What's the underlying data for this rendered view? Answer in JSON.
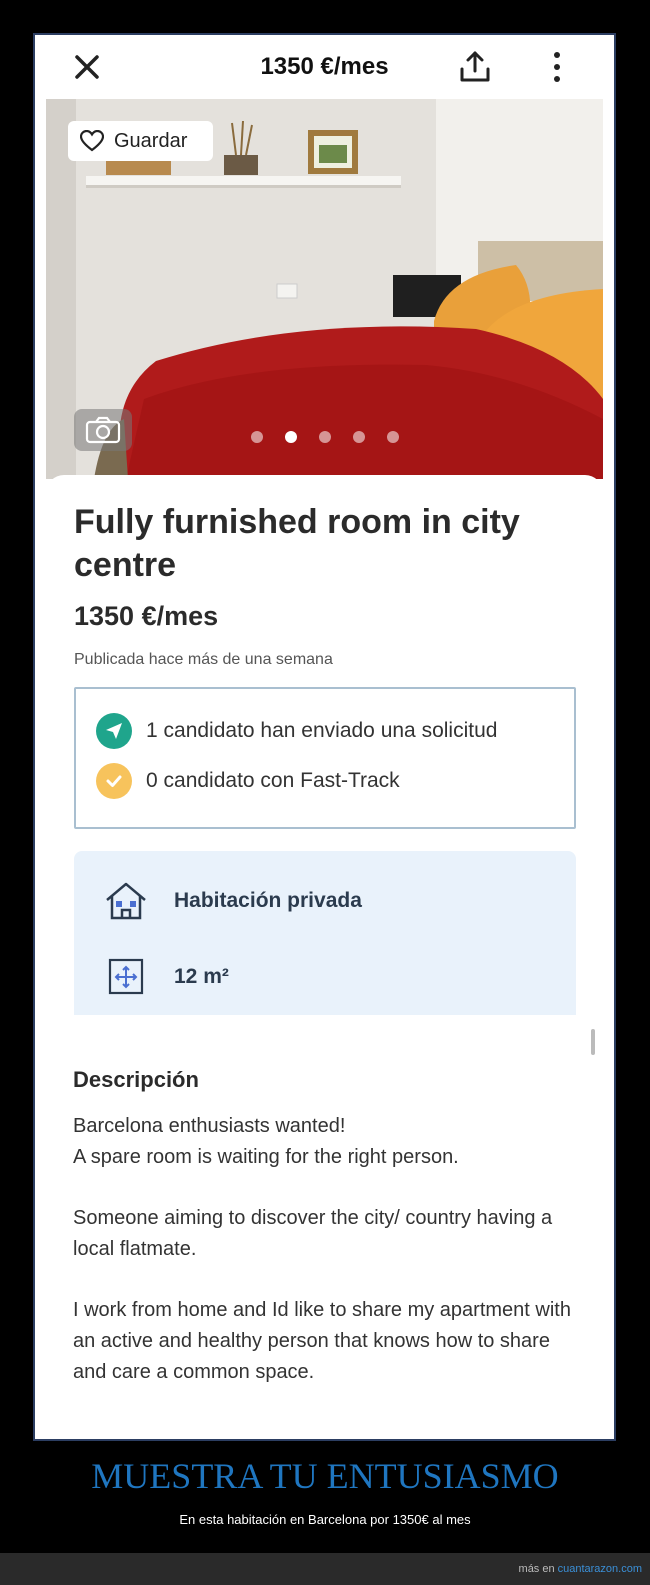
{
  "topbar": {
    "title": "1350 €/mes"
  },
  "photo": {
    "save_label": "Guardar",
    "slide_count": 5,
    "active_slide": 2
  },
  "listing": {
    "title": "Fully furnished room in city centre",
    "price": "1350 €/mes",
    "published": "Publicada hace más de una semana"
  },
  "applicants": {
    "requests": "1 candidato han enviado una solicitud",
    "fast_track": "0 candidato con Fast-Track"
  },
  "features": {
    "room_type": "Habitación privada",
    "size": "12 m²"
  },
  "description": {
    "heading": "Descripción",
    "p1": "Barcelona enthusiasts wanted!\nA spare room is waiting for the right person.",
    "p2": "Someone aiming to discover the city/ country having a local flatmate.",
    "p3": "I work from home and Id like to share my apartment with an active and healthy person that knows how to share and care a common space."
  },
  "caption": {
    "title": "MUESTRA TU ENTUSIASMO",
    "subtitle": "En esta habitación en Barcelona por 1350€ al mes"
  },
  "footer": {
    "prefix": "más en",
    "site": "cuantarazon.com"
  },
  "colors": {
    "teal_check": "#1fa58c",
    "fasttrack_yellow": "#f7c35c",
    "caption_blue": "#1f76c0",
    "feature_bg": "#e9f2fb"
  },
  "icons": [
    "close-icon",
    "share-icon",
    "more-icon",
    "heart-icon",
    "camera-icon",
    "send-icon",
    "check-icon",
    "house-icon",
    "move-icon"
  ]
}
